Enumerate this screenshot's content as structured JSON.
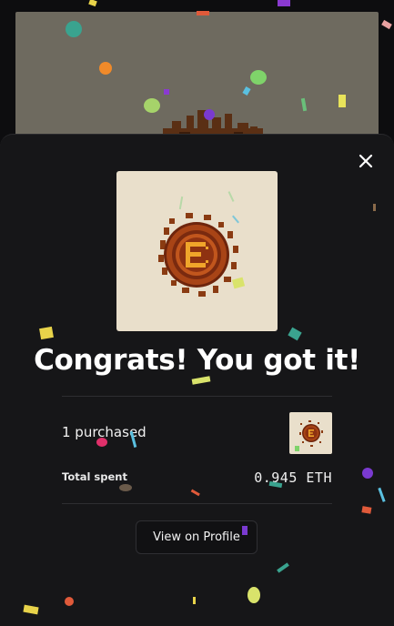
{
  "modal": {
    "title": "Congrats! You got it!",
    "purchased_label": "1 purchased",
    "total_spent_label": "Total spent",
    "total_spent_value": "0.945 ETH",
    "view_button_label": "View on Profile"
  },
  "icons": {
    "close": "close-icon",
    "nft": "coin-nft-image",
    "thumb": "coin-nft-thumbnail"
  },
  "colors": {
    "sheet_bg": "#161618",
    "nft_bg": "#e9dfcb",
    "coin_dark": "#7a2a0f",
    "coin_mid": "#b54a1a",
    "coin_gold": "#f0a52a"
  }
}
